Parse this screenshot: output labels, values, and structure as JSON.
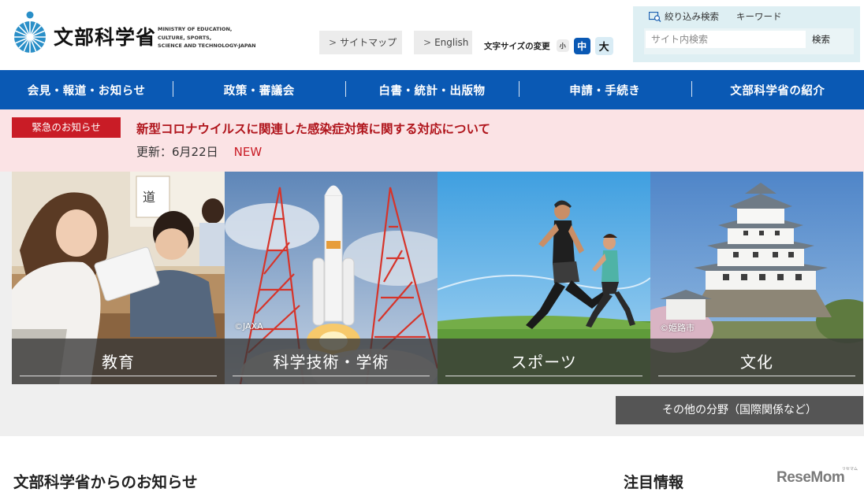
{
  "header": {
    "logo": {
      "jp": "文部科学省",
      "en_lines": [
        "MINISTRY OF EDUCATION,",
        "CULTURE, SPORTS,",
        "SCIENCE AND TECHNOLOGY-JAPAN"
      ],
      "brand_color": "#2a8fc8"
    },
    "sitemap_label": "サイトマップ",
    "english_label": "English",
    "arrow_glyph": ">",
    "fontsize": {
      "label": "文字サイズの変更",
      "small": "小",
      "mid": "中",
      "large": "大"
    },
    "search": {
      "tab_filter": "絞り込み検索",
      "tab_keyword": "キーワード",
      "placeholder": "サイト内検索",
      "button": "検索"
    }
  },
  "nav": {
    "items": [
      "会見・報道・お知らせ",
      "政策・審議会",
      "白書・統計・出版物",
      "申請・手続き",
      "文部科学省の紹介"
    ],
    "color": "#0a59b4"
  },
  "alert": {
    "badge": "緊急のお知らせ",
    "title": "新型コロナウイルスに関連した感染症対策に関する対応について",
    "update": "更新：6月22日",
    "new": "NEW",
    "badge_color": "#c91c26",
    "bg_color": "#fbe3e5"
  },
  "tiles": [
    {
      "label": "教育",
      "credit": ""
    },
    {
      "label": "科学技術・学術",
      "credit": "©JAXA"
    },
    {
      "label": "スポーツ",
      "credit": ""
    },
    {
      "label": "文化",
      "credit": "©姫路市"
    }
  ],
  "other_fields": "その他の分野（国際関係など）",
  "sections": {
    "notices": "文部科学省からのお知らせ",
    "featured": "注目情報"
  },
  "watermark": {
    "text": "ReseMom",
    "sub": "リセマム"
  }
}
